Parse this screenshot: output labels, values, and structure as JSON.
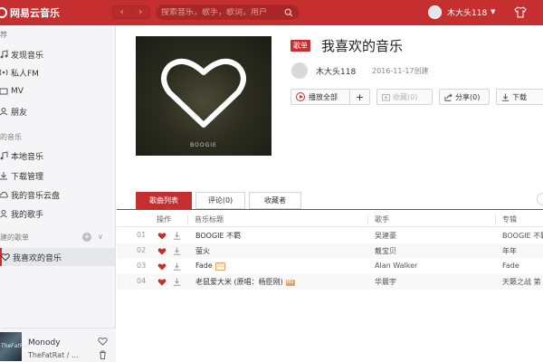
{
  "topbar": {
    "logo_text": "网易云音乐",
    "back_glyph": "‹",
    "forward_glyph": "›",
    "search_placeholder": "搜索音乐，歌手，歌词，用户",
    "username": "木大头118",
    "caret": "▼"
  },
  "sidebar": {
    "section_recommend": "推荐",
    "section_my_music": "我的音乐",
    "section_playlists": "创建的歌单",
    "items": [
      {
        "label": "发现音乐"
      },
      {
        "label": "私人FM"
      },
      {
        "label": "MV"
      },
      {
        "label": "朋友"
      },
      {
        "label": "本地音乐"
      },
      {
        "label": "下载管理"
      },
      {
        "label": "我的音乐云盘"
      },
      {
        "label": "我的歌手"
      },
      {
        "label": "我喜欢的音乐"
      }
    ],
    "add_glyph": "+",
    "collapse_glyph": "∨"
  },
  "now_playing": {
    "cover_text": "TheFatRat",
    "title": "Monody",
    "artist": "TheFatRat / ..."
  },
  "playlist": {
    "cover_label": "BOOGIE",
    "tag": "歌单",
    "title": "我喜欢的音乐",
    "creator": "木大头118",
    "created": "2016-11-17创建",
    "actions": {
      "play_all": "播放全部",
      "add": "+",
      "collect": "收藏(0)",
      "share": "分享(0)",
      "download": "下载"
    }
  },
  "tabs": [
    {
      "label": "歌曲列表",
      "active": true
    },
    {
      "label": "评论(0)",
      "active": false
    },
    {
      "label": "收藏者",
      "active": false
    }
  ],
  "table": {
    "columns": {
      "ops": "操作",
      "title": "音乐标题",
      "artist": "歌手",
      "album": "专辑"
    },
    "rows": [
      {
        "num": "01",
        "title": "BOOGIE 不羁",
        "artist": "吴建豪",
        "album": "BOOGIE 不羁",
        "sq": "",
        "mv": ""
      },
      {
        "num": "02",
        "title": "萤火",
        "artist": "戴宝贝",
        "album": "年年",
        "sq": "",
        "mv": ""
      },
      {
        "num": "03",
        "title": "Fade",
        "artist": "Alan Walker",
        "album": "Fade",
        "sq": "SQ",
        "mv": ""
      },
      {
        "num": "04",
        "title": "老鼠爱大米  (原唱：杨臣刚)",
        "artist": "华晨宇",
        "album": "天籁之战 第",
        "sq": "",
        "mv": "MV"
      }
    ]
  },
  "colors": {
    "accent": "#c62f2f",
    "badge": "#e9a25f"
  }
}
